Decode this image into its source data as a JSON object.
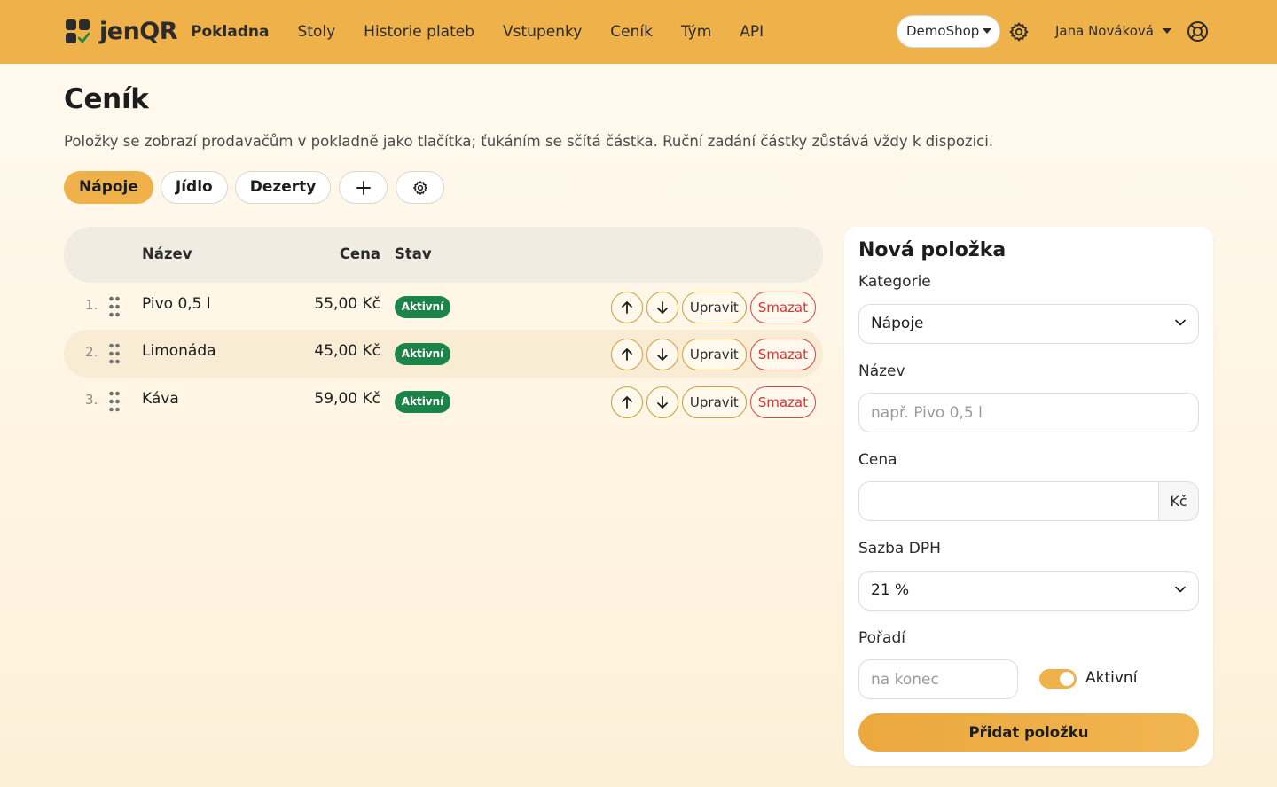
{
  "brand": {
    "name": "jenQR"
  },
  "nav": {
    "links": [
      "Pokladna",
      "Stoly",
      "Historie plateb",
      "Vstupenky",
      "Ceník",
      "Tým",
      "API"
    ],
    "active": "Pokladna",
    "shop": "DemoShop",
    "user": "Jana Nováková"
  },
  "page": {
    "title": "Ceník",
    "description": "Položky se zobrazí prodavačům v pokladně jako tlačítka; ťukáním se sčítá částka. Ruční zadání částky zůstává vždy k dispozici."
  },
  "categories": {
    "items": [
      "Nápoje",
      "Jídlo",
      "Dezerty"
    ],
    "active": "Nápoje",
    "add_icon": "plus-icon",
    "settings_icon": "gear-icon"
  },
  "table": {
    "headers": {
      "name": "Název",
      "price": "Cena",
      "state": "Stav"
    },
    "rows": [
      {
        "num": "1.",
        "name": "Pivo 0,5 l",
        "price": "55,00 Kč",
        "state": "Aktivní"
      },
      {
        "num": "2.",
        "name": "Limonáda",
        "price": "45,00 Kč",
        "state": "Aktivní"
      },
      {
        "num": "3.",
        "name": "Káva",
        "price": "59,00 Kč",
        "state": "Aktivní"
      }
    ],
    "actions": {
      "edit": "Upravit",
      "delete": "Smazat"
    }
  },
  "form": {
    "title": "Nová položka",
    "category_label": "Kategorie",
    "category_value": "Nápoje",
    "name_label": "Název",
    "name_placeholder": "např. Pivo 0,5 l",
    "price_label": "Cena",
    "price_value": "",
    "currency": "Kč",
    "vat_label": "Sazba DPH",
    "vat_value": "21 %",
    "order_label": "Pořadí",
    "order_placeholder": "na konec",
    "active_label": "Aktivní",
    "active_on": true,
    "submit": "Přidat položku"
  },
  "colors": {
    "accent": "#efb14a",
    "badge": "#1a8449",
    "danger": "#d63333",
    "row_highlight": "#f9ecd4"
  }
}
